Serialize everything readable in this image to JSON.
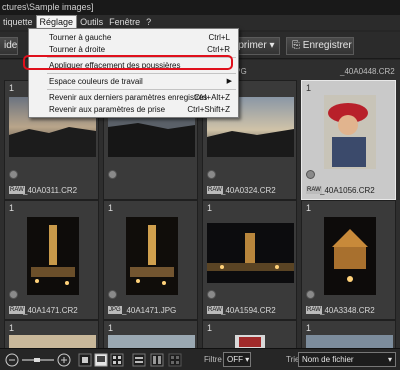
{
  "window": {
    "title": "ctures\\Sample images]"
  },
  "menubar": {
    "items": [
      "tiquette",
      "Réglage",
      "Outils",
      "Fenêtre",
      "?"
    ]
  },
  "menu": {
    "items": [
      {
        "label": "Tourner à gauche",
        "shortcut": "Ctrl+L"
      },
      {
        "label": "Tourner à droite",
        "shortcut": "Ctrl+R"
      },
      {
        "label": "Appliquer effacement des poussières",
        "shortcut": ""
      },
      {
        "label": "Espace couleurs de travail",
        "shortcut": ""
      },
      {
        "label": "Revenir aux derniers paramètres enregistrés",
        "shortcut": "Ctrl+Alt+Z"
      },
      {
        "label": "Revenir aux paramètres de prise",
        "shortcut": "Ctrl+Shift+Z"
      }
    ]
  },
  "toolbar": {
    "left_label": "ide",
    "print_label": "mprimer",
    "save_label": "Enregistrer"
  },
  "grid": {
    "top_names": [
      "",
      "",
      "NX0737.JPG",
      "_40A0448.CR2"
    ],
    "cells": [
      {
        "name": "_40A0311.CR2",
        "rating": "1",
        "type": "RAW"
      },
      {
        "name": "",
        "rating": "1",
        "type": ""
      },
      {
        "name": "_40A0324.CR2",
        "rating": "1",
        "type": "RAW"
      },
      {
        "name": "_40A1056.CR2",
        "rating": "1",
        "type": "RAW"
      },
      {
        "name": "_40A1471.CR2",
        "rating": "1",
        "type": "RAW"
      },
      {
        "name": "_40A1471.JPG",
        "rating": "1",
        "type": "JPG"
      },
      {
        "name": "_40A1594.CR2",
        "rating": "1",
        "type": "RAW"
      },
      {
        "name": "_40A3348.CR2",
        "rating": "1",
        "type": "RAW"
      }
    ],
    "bottom_ratings": [
      "1",
      "1",
      "1",
      "1"
    ]
  },
  "statusbar": {
    "filter_label": "Filtre",
    "filter_value": "OFF",
    "sort_label": "Trier",
    "sort_value": "Nom de fichier"
  },
  "colors": {
    "menu_highlight": "#e0101c",
    "selected_cell": "#c9c9c9"
  }
}
